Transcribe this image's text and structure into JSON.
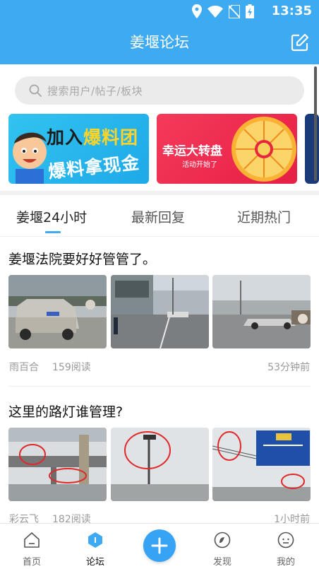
{
  "status": {
    "time": "13:35"
  },
  "header": {
    "title": "姜堰论坛"
  },
  "search": {
    "placeholder": "搜索用户/帖子/板块"
  },
  "banners": [
    {
      "line1a": "加入",
      "line1b": "爆料团",
      "line2": "爆料拿现金"
    },
    {
      "title": "幸运大转盘",
      "subtitle": "活动开始了"
    }
  ],
  "tabs": [
    "姜堰24小时",
    "最新回复",
    "近期热门"
  ],
  "posts": [
    {
      "title": "姜堰法院要好好管管了。",
      "author": "雨百合",
      "reads": "159阅读",
      "time": "53分钟前"
    },
    {
      "title": "这里的路灯谁管理?",
      "author": "彩云飞",
      "reads": "182阅读",
      "time": "1小时前"
    }
  ],
  "nav": {
    "home": "首页",
    "forum": "论坛",
    "discover": "发现",
    "mine": "我的"
  },
  "colors": {
    "primary": "#3eaaf2",
    "fab": "#36a3f4"
  }
}
